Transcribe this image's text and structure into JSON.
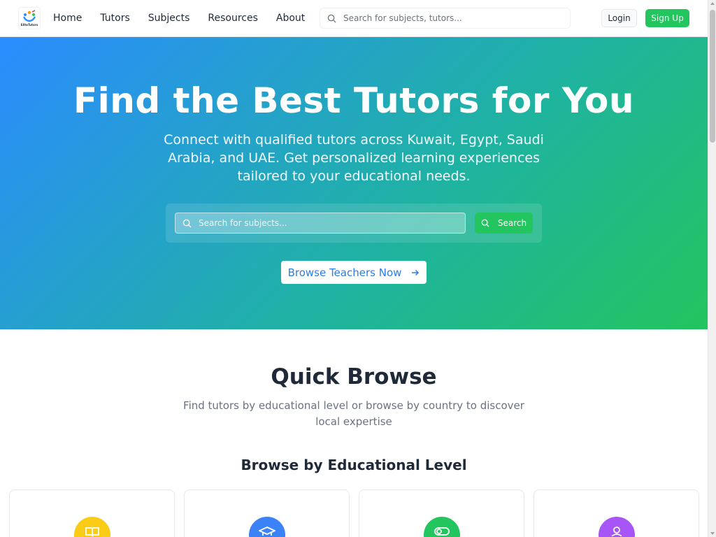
{
  "brand": {
    "logo_text": "EliteTutors"
  },
  "nav": {
    "links": [
      "Home",
      "Tutors",
      "Subjects",
      "Resources",
      "About"
    ],
    "search_placeholder": "Search for subjects, tutors...",
    "login_label": "Login",
    "signup_label": "Sign Up"
  },
  "hero": {
    "title": "Find the Best Tutors for You",
    "subtitle": "Connect with qualified tutors across Kuwait, Egypt, Saudi Arabia, and UAE. Get personalized learning experiences tailored to your educational needs.",
    "search_placeholder": "Search for subjects...",
    "search_button": "Search",
    "browse_button": "Browse Teachers Now"
  },
  "quick_browse": {
    "title": "Quick Browse",
    "subtitle": "Find tutors by educational level or browse by country to discover local expertise",
    "level_heading": "Browse by Educational Level",
    "cards": [
      {
        "icon": "book-icon",
        "color": "#facc15"
      },
      {
        "icon": "graduation-cap-icon",
        "color": "#3b82f6"
      },
      {
        "icon": "toggle-icon",
        "color": "#22c55e"
      },
      {
        "icon": "user-icon",
        "color": "#a855f7"
      }
    ]
  },
  "colors": {
    "primary_green": "#22c55e",
    "primary_blue": "#2b8cff",
    "text_dark": "#1f2937",
    "text_muted": "#6b7280"
  }
}
